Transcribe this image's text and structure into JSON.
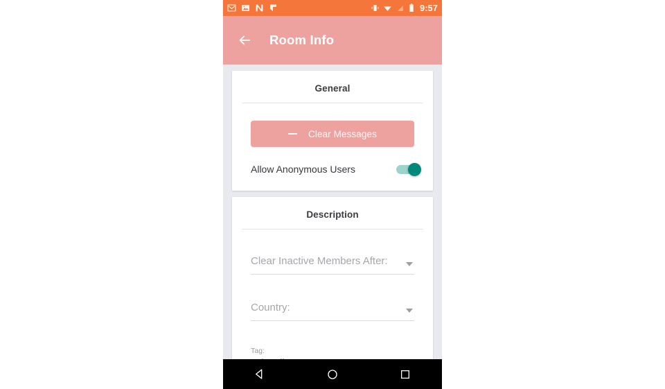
{
  "status_bar": {
    "time": "9:57",
    "left_icons": [
      "gmail-icon",
      "photos-icon",
      "n-app-icon",
      "play-icon"
    ],
    "right_icons": [
      "vibrate-icon",
      "wifi-icon",
      "signal-off-icon",
      "battery-icon"
    ],
    "background_color": "#f4763a"
  },
  "app_bar": {
    "back_icon": "back-arrow-icon",
    "title": "Room Info",
    "background_color": "#eea2a0",
    "text_color": "#ffffff"
  },
  "general_card": {
    "title": "General",
    "clear_button": {
      "label": "Clear Messages",
      "icon": "minus-icon",
      "color": "#eea2a0"
    },
    "anonymous_switch": {
      "label": "Allow Anonymous Users",
      "state": "on",
      "track_color": "#9ed3cc",
      "thumb_color": "#00897b"
    }
  },
  "description_card": {
    "title": "Description",
    "fields": [
      {
        "placeholder": "Clear Inactive Members After:",
        "value": "",
        "float_label": "",
        "icon": "chevron-down-icon"
      },
      {
        "placeholder": "Country:",
        "value": "",
        "float_label": "",
        "icon": "chevron-down-icon"
      },
      {
        "placeholder": "",
        "value": "Friendly",
        "float_label": "Tag:",
        "icon": "chevron-down-icon"
      }
    ]
  },
  "nav_bar": {
    "back": "back-triangle-icon",
    "home": "home-circle-icon",
    "recents": "recents-square-icon"
  }
}
